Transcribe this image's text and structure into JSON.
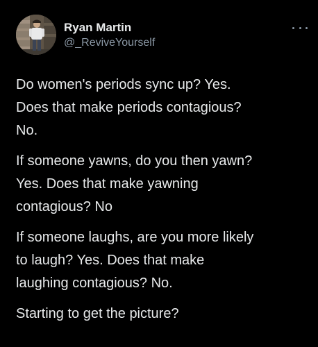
{
  "user": {
    "name": "Ryan Martin",
    "handle": "@_ReviveYourself",
    "avatar_icon": "profile-photo"
  },
  "more_icon": "more-horizontal-icon",
  "tweet": {
    "paragraphs": [
      "Do women's periods sync up? Yes.\nDoes that make periods contagious?\nNo.",
      "If someone yawns, do you then yawn?\nYes. Does that make yawning\ncontagious? No",
      "If someone laughs, are you more likely\nto laugh? Yes. Does that make\nlaughing contagious? No.",
      "Starting to get the picture?"
    ]
  },
  "colors": {
    "background": "#000000",
    "text": "#e7e9ea",
    "secondary": "#8b98a5"
  }
}
